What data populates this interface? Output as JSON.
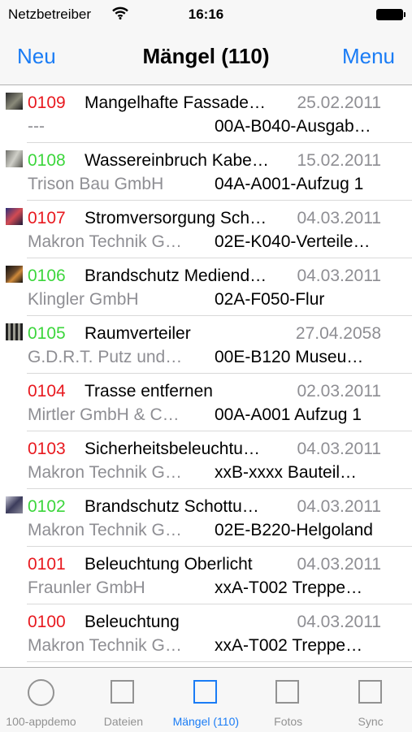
{
  "status_bar": {
    "carrier": "Netzbetreiber",
    "time": "16:16"
  },
  "nav": {
    "left_button": "Neu",
    "title": "Mängel (110)",
    "right_button": "Menu"
  },
  "colors": {
    "accent": "#1a7cf5",
    "status_open": "#e8191f",
    "status_done": "#3cd63c",
    "secondary_text": "#8e8e93"
  },
  "items": [
    {
      "number": "0109",
      "status": "red",
      "has_photo": true,
      "title": "Mangelhafte Fassade…",
      "date": "25.02.2011",
      "company": "---",
      "location": "00A-B040-Ausgab…"
    },
    {
      "number": "0108",
      "status": "green",
      "has_photo": true,
      "title": "Wassereinbruch Kabe…",
      "date": "15.02.2011",
      "company": "Trison Bau GmbH",
      "location": "04A-A001-Aufzug 1"
    },
    {
      "number": "0107",
      "status": "red",
      "has_photo": true,
      "title": "Stromversorgung Sch…",
      "date": "04.03.2011",
      "company": "Makron Technik G…",
      "location": "02E-K040-Verteile…"
    },
    {
      "number": "0106",
      "status": "green",
      "has_photo": true,
      "title": "Brandschutz Mediend…",
      "date": "04.03.2011",
      "company": "Klingler GmbH",
      "location": "02A-F050-Flur"
    },
    {
      "number": "0105",
      "status": "green",
      "has_photo": true,
      "title": "Raumverteiler",
      "date": "27.04.2058",
      "company": "G.D.R.T. Putz und…",
      "location": "00E-B120 Museu…"
    },
    {
      "number": "0104",
      "status": "red",
      "has_photo": false,
      "title": "Trasse entfernen",
      "date": "02.03.2011",
      "company": "Mirtler GmbH & C…",
      "location": "00A-A001 Aufzug 1"
    },
    {
      "number": "0103",
      "status": "red",
      "has_photo": false,
      "title": "Sicherheitsbeleuchtu…",
      "date": "04.03.2011",
      "company": "Makron Technik G…",
      "location": "xxB-xxxx Bauteil…"
    },
    {
      "number": "0102",
      "status": "green",
      "has_photo": true,
      "title": "Brandschutz Schottu…",
      "date": "04.03.2011",
      "company": "Makron Technik G…",
      "location": "02E-B220-Helgoland"
    },
    {
      "number": "0101",
      "status": "red",
      "has_photo": false,
      "title": "Beleuchtung Oberlicht",
      "date": "04.03.2011",
      "company": "Fraunler GmbH",
      "location": "xxA-T002 Treppe…"
    },
    {
      "number": "0100",
      "status": "red",
      "has_photo": false,
      "title": "Beleuchtung",
      "date": "04.03.2011",
      "company": "Makron Technik G…",
      "location": "xxA-T002 Treppe…"
    }
  ],
  "tabs": [
    {
      "label": "100-appdemo",
      "icon": "circle-icon",
      "active": false
    },
    {
      "label": "Dateien",
      "icon": "square-icon",
      "active": false
    },
    {
      "label": "Mängel (110)",
      "icon": "square-icon",
      "active": true
    },
    {
      "label": "Fotos",
      "icon": "square-icon",
      "active": false
    },
    {
      "label": "Sync",
      "icon": "square-icon",
      "active": false
    }
  ]
}
